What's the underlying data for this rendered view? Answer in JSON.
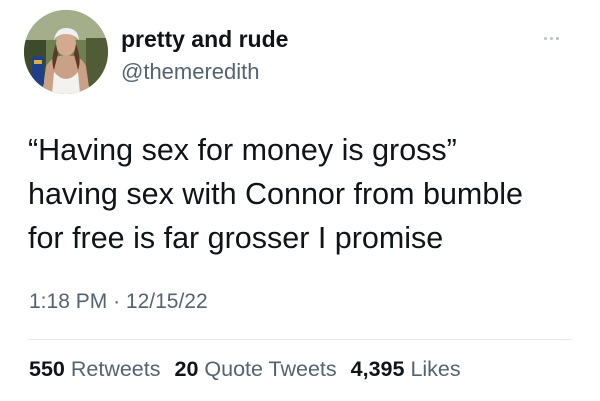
{
  "user": {
    "display_name": "pretty and rude",
    "handle": "@themeredith"
  },
  "tweet": {
    "lines": [
      "“Having sex for money is gross”",
      "having sex with Connor from bumble",
      "for free is far grosser I promise"
    ],
    "time": "1:18 PM",
    "separator": "·",
    "date": "12/15/22"
  },
  "stats": {
    "retweets": {
      "count": "550",
      "label": "Retweets"
    },
    "quotes": {
      "count": "20",
      "label": "Quote Tweets"
    },
    "likes": {
      "count": "4,395",
      "label": "Likes"
    }
  },
  "icons": {
    "more": "more-options-icon"
  },
  "colors": {
    "text": "#0f1419",
    "secondary": "#536471",
    "divider": "#e3e7ea"
  }
}
